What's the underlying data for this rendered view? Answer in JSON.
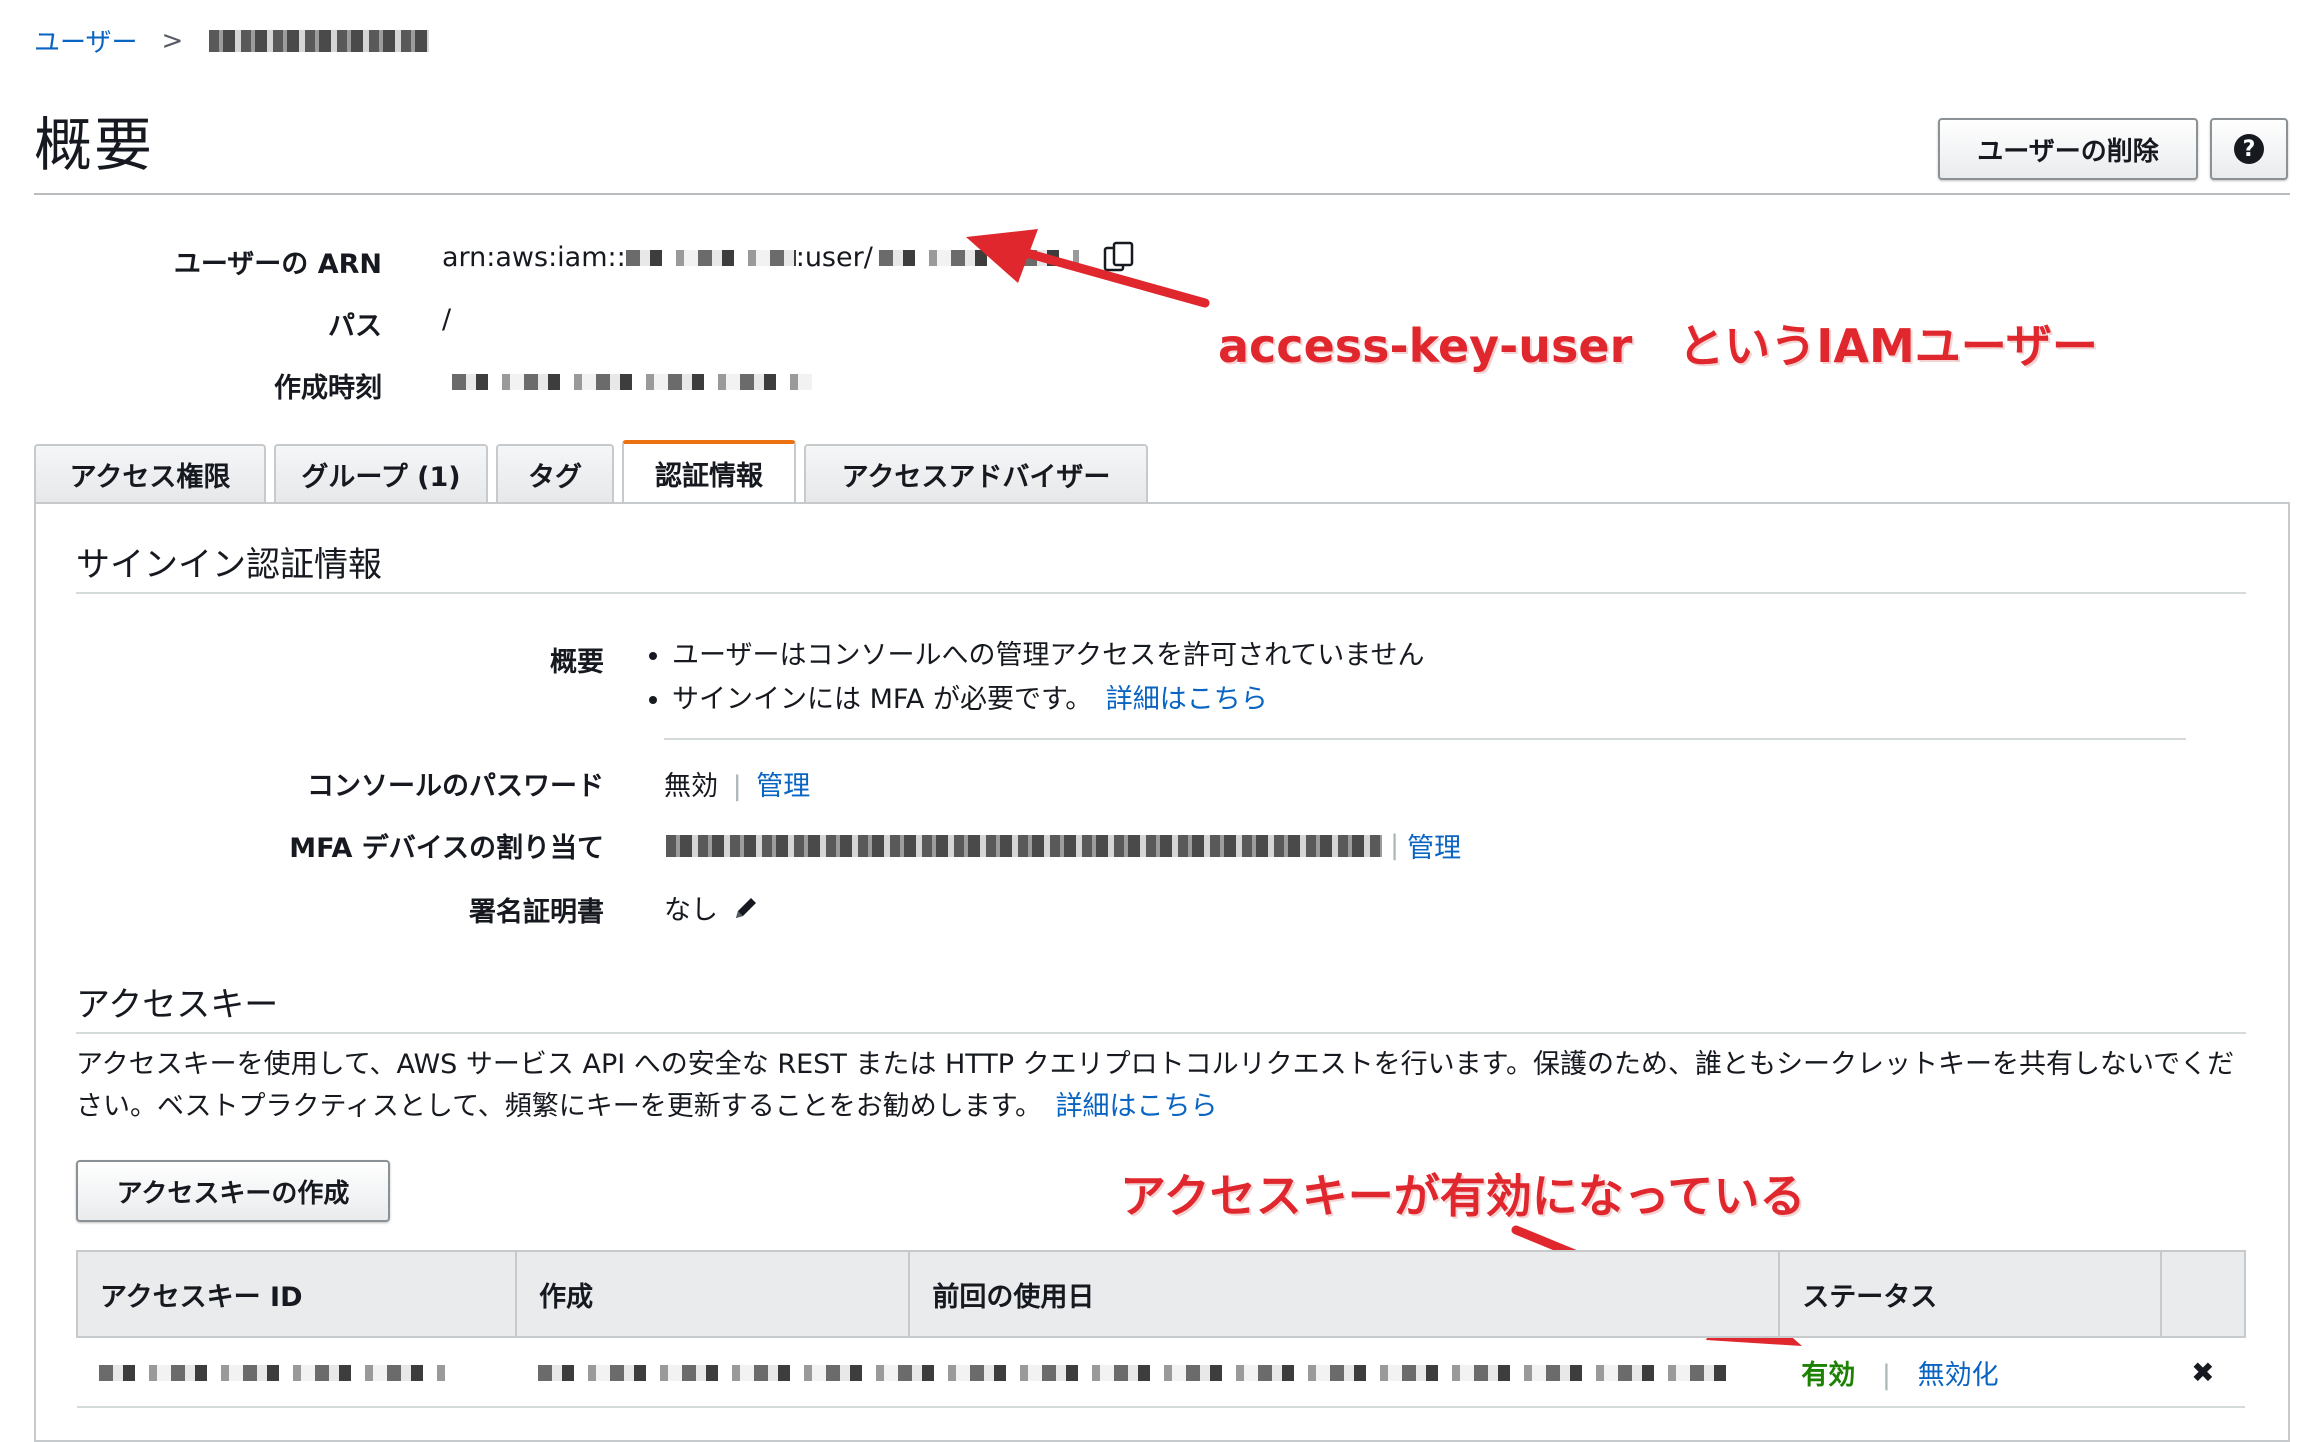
{
  "breadcrumb": {
    "root": "ユーザー",
    "separator": ">"
  },
  "page": {
    "title": "概要",
    "delete_user_label": "ユーザーの削除",
    "help_label": "?"
  },
  "summary": {
    "arn_label": "ユーザーの ARN",
    "arn_prefix": "arn:aws:iam::",
    "arn_mid": ":user/",
    "path_label": "パス",
    "path_value": "/",
    "created_label": "作成時刻"
  },
  "annotations": {
    "user_note": "access-key-user　というIAMユーザー",
    "key_note": "アクセスキーが有効になっている",
    "color": "#e0272e"
  },
  "tabs": [
    {
      "label": "アクセス権限"
    },
    {
      "label": "グループ (1)"
    },
    {
      "label": "タグ"
    },
    {
      "label": "認証情報",
      "active": true
    },
    {
      "label": "アクセスアドバイザー"
    }
  ],
  "signin": {
    "heading": "サインイン認証情報",
    "overview_label": "概要",
    "bullets": [
      "ユーザーはコンソールへの管理アクセスを許可されていません",
      "サインインには MFA が必要です。"
    ],
    "details_link": "詳細はこちら",
    "console_password_label": "コンソールのパスワード",
    "console_password_value": "無効",
    "manage_label": "管理",
    "mfa_label": "MFA デバイスの割り当て",
    "signing_cert_label": "署名証明書",
    "signing_cert_value": "なし"
  },
  "access_keys": {
    "heading": "アクセスキー",
    "description": "アクセスキーを使用して、AWS サービス API への安全な REST または HTTP クエリプロトコルリクエストを行います。保護のため、誰ともシークレットキーを共有しないでください。ベストプラクティスとして、頻繁にキーを更新することをお勧めします。",
    "details_link": "詳細はこちら",
    "create_button": "アクセスキーの作成",
    "columns": [
      "アクセスキー ID",
      "作成",
      "前回の使用日",
      "ステータス"
    ],
    "row": {
      "status": "有効",
      "deactivate": "無効化",
      "delete_symbol": "✖"
    },
    "status_color": "#1d8102"
  }
}
